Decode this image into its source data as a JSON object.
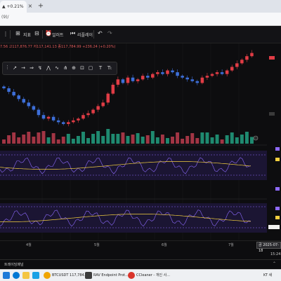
{
  "browser": {
    "tab_title": "▲ +0.21%",
    "tab_close": "×",
    "new_tab": "+",
    "url_text": "(9)/"
  },
  "toolbar": {
    "indicators_label": "지표",
    "alerts_label": "얼러트",
    "replay_label": "리플레이"
  },
  "ohlc_text": "7.56 고117,876.77 저117,141.13 종117,784.99 +236.24 (+0.20%)",
  "drawing_tools": [
    "↗",
    "→",
    "⇒",
    "↯",
    "⋀",
    "∿",
    "⋔",
    "⊕",
    "⊡",
    "▢",
    "T",
    "Tₜ"
  ],
  "time_axis": {
    "labels": [
      "4월",
      "5월",
      "6월",
      "7월"
    ],
    "date_badge": "금 2025-07-18"
  },
  "time_now": "15:24",
  "bottom_panel_title": "트레이딩패널",
  "taskbar": {
    "apps": [
      {
        "label": "BTCUSDT 117,784...",
        "color": "#f0a500"
      },
      {
        "label": "RAV Endpoint Prot...",
        "color": "#3c3c3c"
      },
      {
        "label": "CCleaner - 개인 사...",
        "color": "#d9342b"
      }
    ],
    "tray_text": "KT 새"
  },
  "chart_data": {
    "type": "candlestick",
    "x_labels": [
      "4월",
      "5월",
      "6월",
      "7월"
    ],
    "approx_closes": [
      98,
      96,
      94,
      92,
      90,
      88,
      86,
      83,
      81,
      82,
      80,
      79,
      78,
      79,
      80,
      81,
      83,
      84,
      86,
      88,
      90,
      95,
      100,
      103,
      101,
      104,
      102,
      103,
      105,
      104,
      106,
      107,
      106,
      108,
      107,
      105,
      104,
      103,
      102,
      101,
      104,
      105,
      106,
      107,
      106,
      108,
      110,
      112,
      114,
      116,
      117.8
    ],
    "note": ""
  },
  "colors": {
    "up": "#e03c45",
    "down": "#3d6fd9",
    "vol_up": "#1f8a70",
    "vol_down": "#a23544",
    "accent": "#d9342b"
  }
}
